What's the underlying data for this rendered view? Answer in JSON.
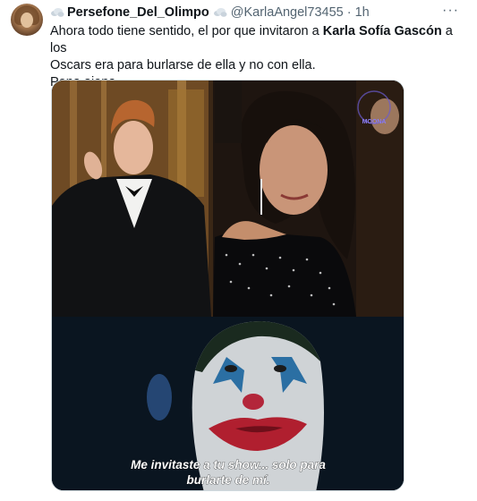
{
  "tweet": {
    "display_name": "Persefone_Del_Olimpo",
    "handle": "@KarlaAngel73455",
    "separator": "·",
    "time": "1h",
    "more_label": "···",
    "text_line1_a": "Ahora todo tiene sentido, el por que invitaron a ",
    "text_line1_bold": "Karla Sofía Gascón",
    "text_line1_b": " a los",
    "text_line2": "Oscars era para burlarse de ella y no con ella.",
    "text_line3": "Pena ajena."
  },
  "media": {
    "watermark": "MOONA",
    "subtitle_line1": "Me invitaste a tu show... solo para",
    "subtitle_line2": "burlarte de mí."
  },
  "icons": {
    "deco_left": "cloud-emoji-icon",
    "deco_right": "cloud-emoji-icon",
    "more": "more-options-icon"
  }
}
